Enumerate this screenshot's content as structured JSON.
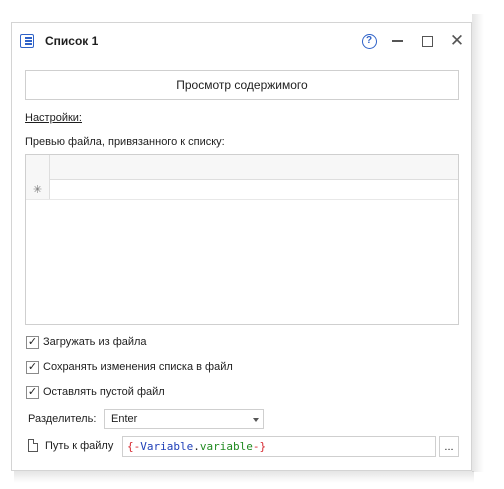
{
  "window": {
    "title": "Список 1",
    "help_glyph": "?",
    "minimize_icon": "minimize-icon",
    "maximize_icon": "maximize-icon",
    "close_glyph": "✕"
  },
  "main": {
    "view_button_label": "Просмотр содержимого",
    "settings_label": "Настройки:",
    "preview_label": "Превью файла, привязанного к списку:",
    "grid": {
      "new_row_marker": "✳",
      "rows": []
    },
    "checkboxes": [
      {
        "label": "Загружать из файла",
        "checked": true
      },
      {
        "label": "Сохранять изменения списка в файл",
        "checked": true
      },
      {
        "label": "Оставлять пустой файл",
        "checked": true
      }
    ],
    "checkbox_mark": "✓",
    "separator": {
      "label": "Разделитель:",
      "value": "Enter"
    },
    "path": {
      "label": "Путь к файлу",
      "value": "{-Variable.variable-}",
      "value_parts": {
        "open": "{-",
        "object": "Variable",
        "dot": ".",
        "field": "variable",
        "close": "-}"
      },
      "browse_label": "..."
    }
  }
}
